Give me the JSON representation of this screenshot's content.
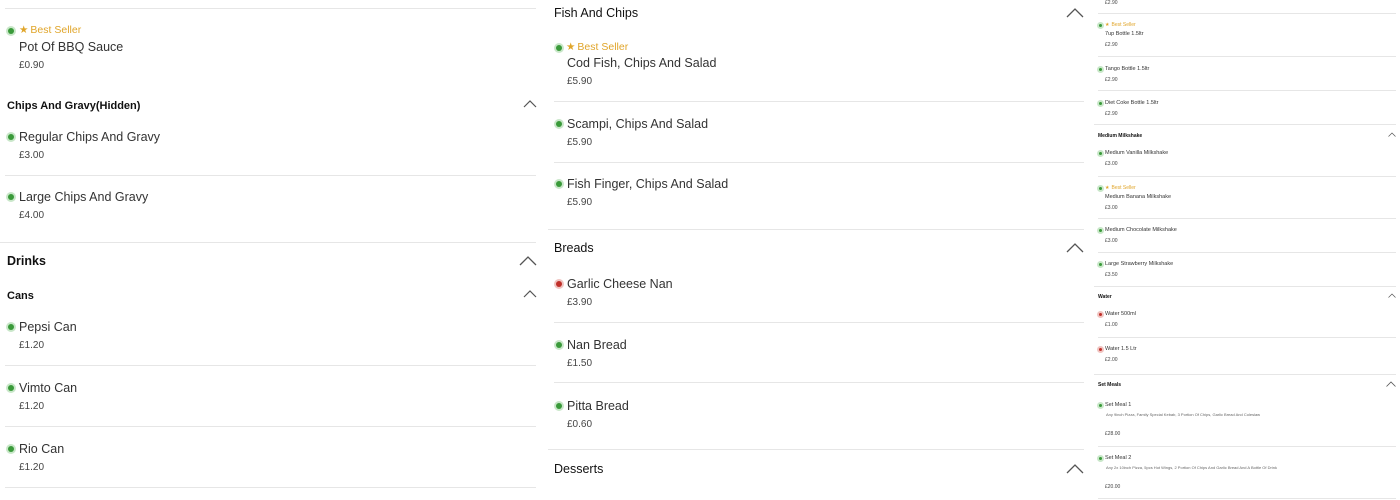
{
  "col1": {
    "top_item": {
      "best": "Best Seller",
      "name": "Pot Of BBQ Sauce",
      "price": "£0.90"
    },
    "chips_gravy": {
      "title": "Chips And Gravy(Hidden)",
      "items": [
        {
          "name": "Regular Chips And Gravy",
          "price": "£3.00"
        },
        {
          "name": "Large Chips And Gravy",
          "price": "£4.00"
        }
      ]
    },
    "drinks_title": "Drinks",
    "cans": {
      "title": "Cans",
      "items": [
        {
          "name": "Pepsi Can",
          "price": "£1.20"
        },
        {
          "name": "Vimto Can",
          "price": "£1.20"
        },
        {
          "name": "Rio Can",
          "price": "£1.20"
        }
      ]
    }
  },
  "col2": {
    "fish_chips": {
      "title": "Fish And Chips",
      "items": [
        {
          "best": "Best Seller",
          "name": "Cod Fish, Chips And Salad",
          "price": "£5.90"
        },
        {
          "name": "Scampi, Chips And Salad",
          "price": "£5.90"
        },
        {
          "name": "Fish Finger, Chips And Salad",
          "price": "£5.90"
        }
      ]
    },
    "breads": {
      "title": "Breads",
      "items": [
        {
          "name": "Garlic Cheese Nan",
          "price": "£3.90"
        },
        {
          "name": "Nan Bread",
          "price": "£1.50"
        },
        {
          "name": "Pitta Bread",
          "price": "£0.60"
        }
      ]
    },
    "desserts_title": "Desserts"
  },
  "col3": {
    "top_price": "£2.90",
    "bottles": [
      {
        "best": "Best Seller",
        "name": "7up Bottle 1.5ltr",
        "price": "£2.90"
      },
      {
        "name": "Tango Bottle 1.5ltr",
        "price": "£2.90"
      },
      {
        "name": "Diet Coke Bottle 1.5ltr",
        "price": "£2.90"
      }
    ],
    "milkshake": {
      "title": "Medium Milkshake",
      "items": [
        {
          "name": "Medium Vanilla Milkshake",
          "price": "£3.00"
        },
        {
          "best": "Best Seller",
          "name": "Medium Banana Milkshake",
          "price": "£3.00"
        },
        {
          "name": "Medium Chocolate Milkshake",
          "price": "£3.00"
        },
        {
          "name": "Large Strawberry Milkshake",
          "price": "£3.50"
        }
      ]
    },
    "water": {
      "title": "Water",
      "items": [
        {
          "name": "Water 500ml",
          "price": "£1.00"
        },
        {
          "name": "Water 1.5 Ltr",
          "price": "£2.00"
        }
      ]
    },
    "set_meals": {
      "title": "Set Meals",
      "items": [
        {
          "name": "Set Meal 1",
          "desc": "Any 9inch Pizza, Family Special Kebab, 3 Portion Of Chips, Garlic Bread And Coleslaw",
          "price": "£28.00"
        },
        {
          "name": "Set Meal 2",
          "desc": "Any 2x 10inch Pizza, 5pcs Hot Wings, 2 Portion Of Chips And Garlic Bread And A Bottle Of Drink",
          "price": "£20.00"
        }
      ]
    }
  },
  "colors": {
    "accent": "#e0a52a",
    "veg": "#3a9a3a",
    "nonveg": "#c0302a"
  }
}
